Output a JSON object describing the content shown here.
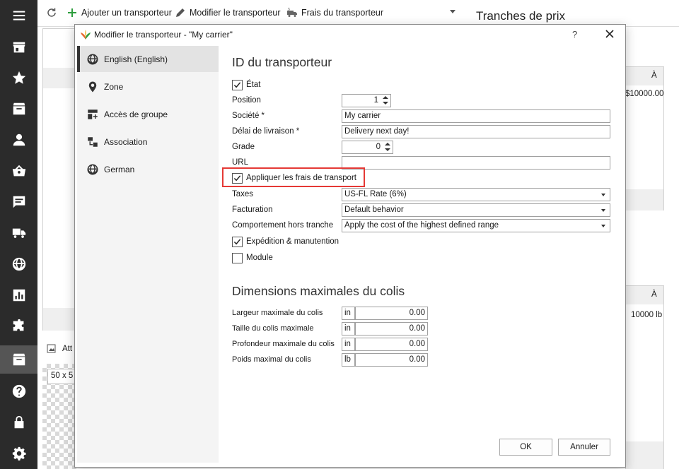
{
  "toolbar": {
    "refresh_icon": "refresh-icon",
    "add_carrier": "Ajouter un transporteur",
    "edit_carrier": "Modifier le transporteur",
    "carrier_fees": "Frais du transporteur"
  },
  "background": {
    "heading": "Tranches de prix",
    "col_to_1": "À",
    "price_value": "$10000.00",
    "col_to_2": "À",
    "weight_value": "10000 lb",
    "attach_label": "Att",
    "size_label": "50 x 5"
  },
  "sidebar": {
    "items": [
      "menu-icon",
      "store-icon",
      "star-icon",
      "box-icon",
      "user-icon",
      "basket-icon",
      "message-icon",
      "truck-icon",
      "globe-icon",
      "chart-icon",
      "puzzle-icon",
      "inbox-icon",
      "help-icon",
      "lock-icon",
      "gear-icon"
    ],
    "active_index": 11
  },
  "dialog": {
    "title": "Modifier le transporteur - \"My carrier\"",
    "help": "?",
    "nav": [
      {
        "label": "English (English)",
        "icon": "globe-icon"
      },
      {
        "label": "Zone",
        "icon": "location-pin-icon"
      },
      {
        "label": "Accès de groupe",
        "icon": "group-add-icon"
      },
      {
        "label": "Association",
        "icon": "association-icon"
      },
      {
        "label": "German",
        "icon": "globe-icon"
      }
    ],
    "section1_title": "ID du transporteur",
    "etat": {
      "label": "État",
      "checked": true
    },
    "position": {
      "label": "Position",
      "value": "1"
    },
    "societe": {
      "label": "Société *",
      "value": "My carrier"
    },
    "delai": {
      "label": "Délai de livraison *",
      "value": "Delivery next day!"
    },
    "grade": {
      "label": "Grade",
      "value": "0"
    },
    "url": {
      "label": "URL",
      "value": ""
    },
    "frais": {
      "label": "Appliquer les frais de transport",
      "checked": true
    },
    "taxes": {
      "label": "Taxes",
      "value": "US-FL Rate (6%)"
    },
    "facturation": {
      "label": "Facturation",
      "value": "Default behavior"
    },
    "hors_tranche": {
      "label": "Comportement hors tranche",
      "value": "Apply the cost of the highest defined range"
    },
    "expedition": {
      "label": "Expédition & manutention",
      "checked": true
    },
    "module": {
      "label": "Module",
      "checked": false
    },
    "section2_title": "Dimensions maximales du colis",
    "dimensions": [
      {
        "label": "Largeur maximale du colis",
        "unit": "in",
        "value": "0.00"
      },
      {
        "label": "Taille du colis maximale",
        "unit": "in",
        "value": "0.00"
      },
      {
        "label": "Profondeur maximale du colis",
        "unit": "in",
        "value": "0.00"
      },
      {
        "label": "Poids maximal du colis",
        "unit": "lb",
        "value": "0.00"
      }
    ],
    "ok": "OK",
    "cancel": "Annuler"
  },
  "colors": {
    "sidebar_bg": "#2b2b2b",
    "highlight": "#e53935",
    "accent_green": "#2e9e3e"
  }
}
